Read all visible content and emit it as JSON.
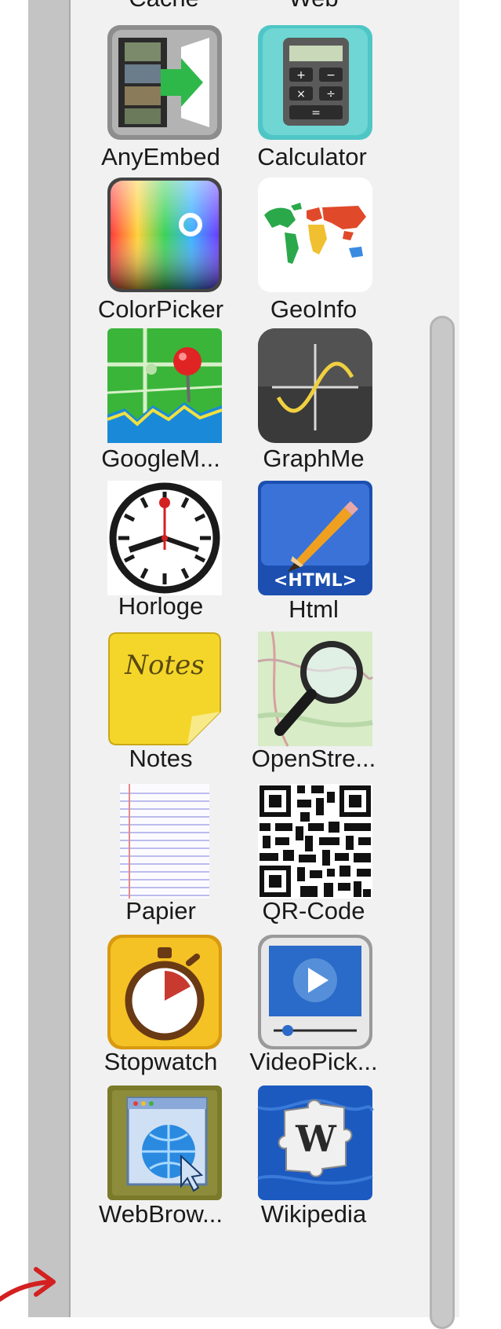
{
  "partial_labels": {
    "left": "Cache",
    "right": "Web"
  },
  "apps": [
    {
      "label": "AnyEmbed",
      "icon": "film-arrow-icon"
    },
    {
      "label": "Calculator",
      "icon": "calculator-icon"
    },
    {
      "label": "ColorPicker",
      "icon": "color-gradient-icon"
    },
    {
      "label": "GeoInfo",
      "icon": "world-map-icon"
    },
    {
      "label": "GoogleM...",
      "icon": "map-pin-icon"
    },
    {
      "label": "GraphMe",
      "icon": "sine-graph-icon"
    },
    {
      "label": "Horloge",
      "icon": "clock-icon"
    },
    {
      "label": "Html",
      "icon": "html-pencil-icon",
      "badge": "<HTML>"
    },
    {
      "label": "Notes",
      "icon": "sticky-note-icon",
      "badge": "Notes"
    },
    {
      "label": "OpenStre...",
      "icon": "map-magnifier-icon"
    },
    {
      "label": "Papier",
      "icon": "lined-paper-icon"
    },
    {
      "label": "QR-Code",
      "icon": "qr-code-icon"
    },
    {
      "label": "Stopwatch",
      "icon": "stopwatch-icon"
    },
    {
      "label": "VideoPick...",
      "icon": "video-player-icon"
    },
    {
      "label": "WebBrow...",
      "icon": "web-browser-icon"
    },
    {
      "label": "Wikipedia",
      "icon": "wikipedia-puzzle-icon",
      "badge": "W"
    }
  ],
  "colors": {
    "panel_bg": "#f1f1f1",
    "annotation_arrow": "#d42020"
  }
}
